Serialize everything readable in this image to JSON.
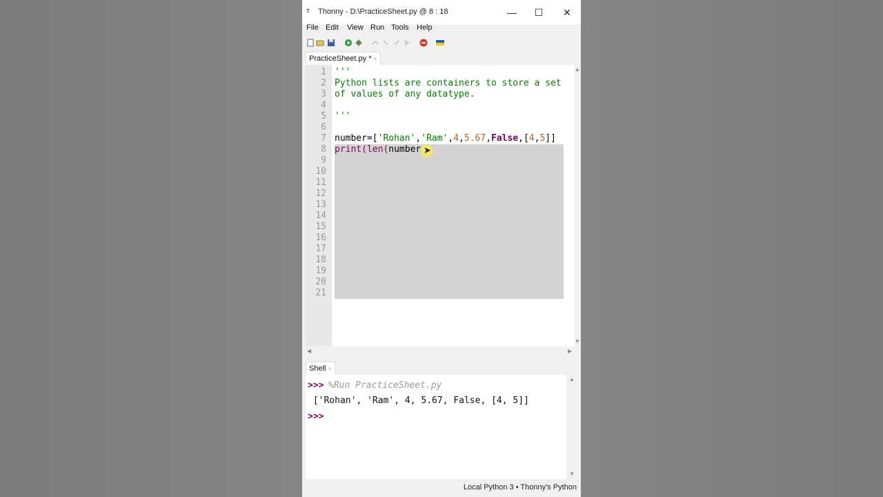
{
  "window": {
    "title": "Thonny  -  D:\\PracticeSheet.py  @  8 : 18",
    "minimize": "—",
    "maximize": "☐",
    "close": "✕"
  },
  "menu": [
    "File",
    "Edit",
    "View",
    "Run",
    "Tools",
    "Help"
  ],
  "toolbar": {
    "icons": [
      "new-file-icon",
      "open-file-icon",
      "save-icon",
      "run-icon",
      "debug-icon",
      "step-over-icon",
      "step-into-icon",
      "step-out-icon",
      "resume-icon",
      "stop-icon",
      "ukraine-flag-icon"
    ]
  },
  "editor": {
    "tab_label": "PracticeSheet.py *",
    "tab_close": "×",
    "line_numbers": [
      "1",
      "2",
      "3",
      "4",
      "5",
      "6",
      "7",
      "8",
      "9",
      "10",
      "11",
      "12",
      "13",
      "14",
      "15",
      "16",
      "17",
      "18",
      "19",
      "20",
      "21"
    ],
    "lines": {
      "l1": "'''",
      "l2": "Python lists are containers to store a set",
      "l3": "of values of any datatype.",
      "l5": "'''",
      "l7_a": "number=[",
      "l7_b": "'Rohan'",
      "l7_c": ",",
      "l7_d": "'Ram'",
      "l7_e": ",",
      "l7_f": "4",
      "l7_g": ",",
      "l7_h": "5.67",
      "l7_i": ",",
      "l7_j": "False",
      "l7_k": ",[",
      "l7_l": "4",
      "l7_m": ",",
      "l7_n": "5",
      "l7_o": "]]",
      "l8_a": "print(",
      "l8_b": "len(",
      "l8_c": "number"
    }
  },
  "shell": {
    "tab_label": "Shell",
    "tab_close": "×",
    "prompt": ">>>",
    "run_command": "%Run PracticeSheet.py",
    "output": " ['Rohan', 'Ram', 4, 5.67, False, [4, 5]]"
  },
  "status": "Local Python 3  •  Thonny's Python",
  "colors": {
    "string": "#008000",
    "keyword": "#7f0055",
    "number": "#b5651d",
    "prompt": "#7f0055"
  }
}
